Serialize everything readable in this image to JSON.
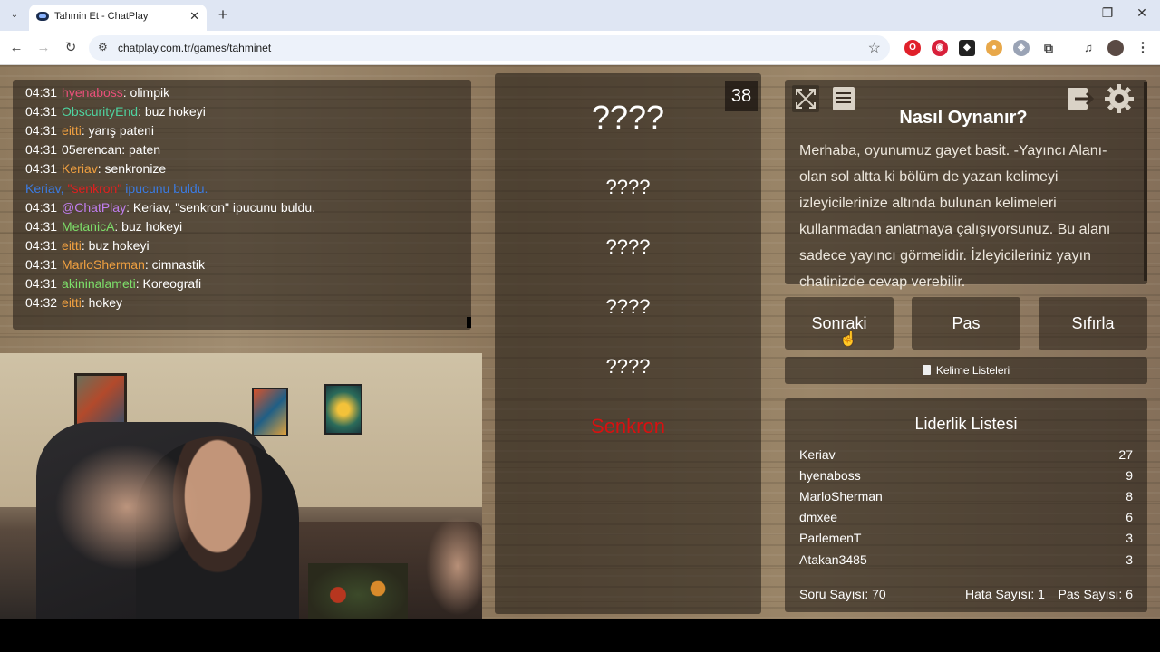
{
  "browser": {
    "tab_title": "Tahmin Et - ChatPlay",
    "url": "chatplay.com.tr/games/tahminet"
  },
  "chat": {
    "messages": [
      {
        "time": "04:31",
        "user": "hyenaboss",
        "user_color": "#e8507a",
        "text": ": olimpik"
      },
      {
        "time": "04:31",
        "user": "ObscurityEnd",
        "user_color": "#4fd3a0",
        "text": ": buz hokeyi"
      },
      {
        "time": "04:31",
        "user": "eitti",
        "user_color": "#f0a040",
        "text": ": yarış pateni"
      },
      {
        "time": "04:31",
        "user": "05erencan",
        "user_color": "#ffffff",
        "text": ": paten"
      },
      {
        "time": "04:31",
        "user": "Keriav",
        "user_color": "#f0a040",
        "text": ": senkronize"
      },
      {
        "time": "",
        "user": "Keriav,",
        "user_color": "#3c7be0",
        "text": "ipucunu buldu.",
        "highlight": "\"senkron\"",
        "system": true
      },
      {
        "time": "04:31",
        "user": "@ChatPlay",
        "user_color": "#c07ef0",
        "text": ": Keriav, \"senkron\" ipucunu buldu."
      },
      {
        "time": "04:31",
        "user": "MetanicA",
        "user_color": "#7de06a",
        "text": ": buz hokeyi"
      },
      {
        "time": "04:31",
        "user": "eitti",
        "user_color": "#f0a040",
        "text": ": buz hokeyi"
      },
      {
        "time": "04:31",
        "user": "MarloSherman",
        "user_color": "#f0a040",
        "text": ": cimnastik"
      },
      {
        "time": "04:31",
        "user": "akininalameti",
        "user_color": "#7de06a",
        "text": ": Koreografi"
      },
      {
        "time": "04:32",
        "user": "eitti",
        "user_color": "#f0a040",
        "text": ": hokey"
      }
    ]
  },
  "game": {
    "counter": "38",
    "main_word": "????",
    "hidden_words": [
      "????",
      "????",
      "????",
      "????"
    ],
    "found_word": "Senkron",
    "found_color": "#d81010"
  },
  "howto": {
    "title": "Nasıl Oynanır?",
    "description": "Merhaba, oyunumuz gayet basit. -Yayıncı Alanı- olan sol altta ki bölüm de yazan kelimeyi izleyicilerinize altında bulunan kelimeleri kullanmadan anlatmaya çalışıyorsunuz. Bu alanı sadece yayıncı görmelidir. İzleyicileriniz yayın chatinizde cevap verebilir.",
    "icons": [
      "fullscreen-icon",
      "list-icon",
      "exit-icon",
      "gear-icon"
    ]
  },
  "actions": {
    "next": "Sonraki",
    "pass": "Pas",
    "reset": "Sıfırla",
    "word_lists": "Kelime Listeleri"
  },
  "leaderboard": {
    "title": "Liderlik Listesi",
    "rows": [
      {
        "name": "Keriav",
        "score": "27"
      },
      {
        "name": "hyenaboss",
        "score": "9"
      },
      {
        "name": "MarloSherman",
        "score": "8"
      },
      {
        "name": "dmxee",
        "score": "6"
      },
      {
        "name": "ParlemenT",
        "score": "3"
      },
      {
        "name": "Atakan3485",
        "score": "3"
      }
    ],
    "question_count": "Soru Sayısı: 70",
    "error_count": "Hata Sayısı: 1",
    "pass_count": "Pas Sayısı: 6"
  }
}
